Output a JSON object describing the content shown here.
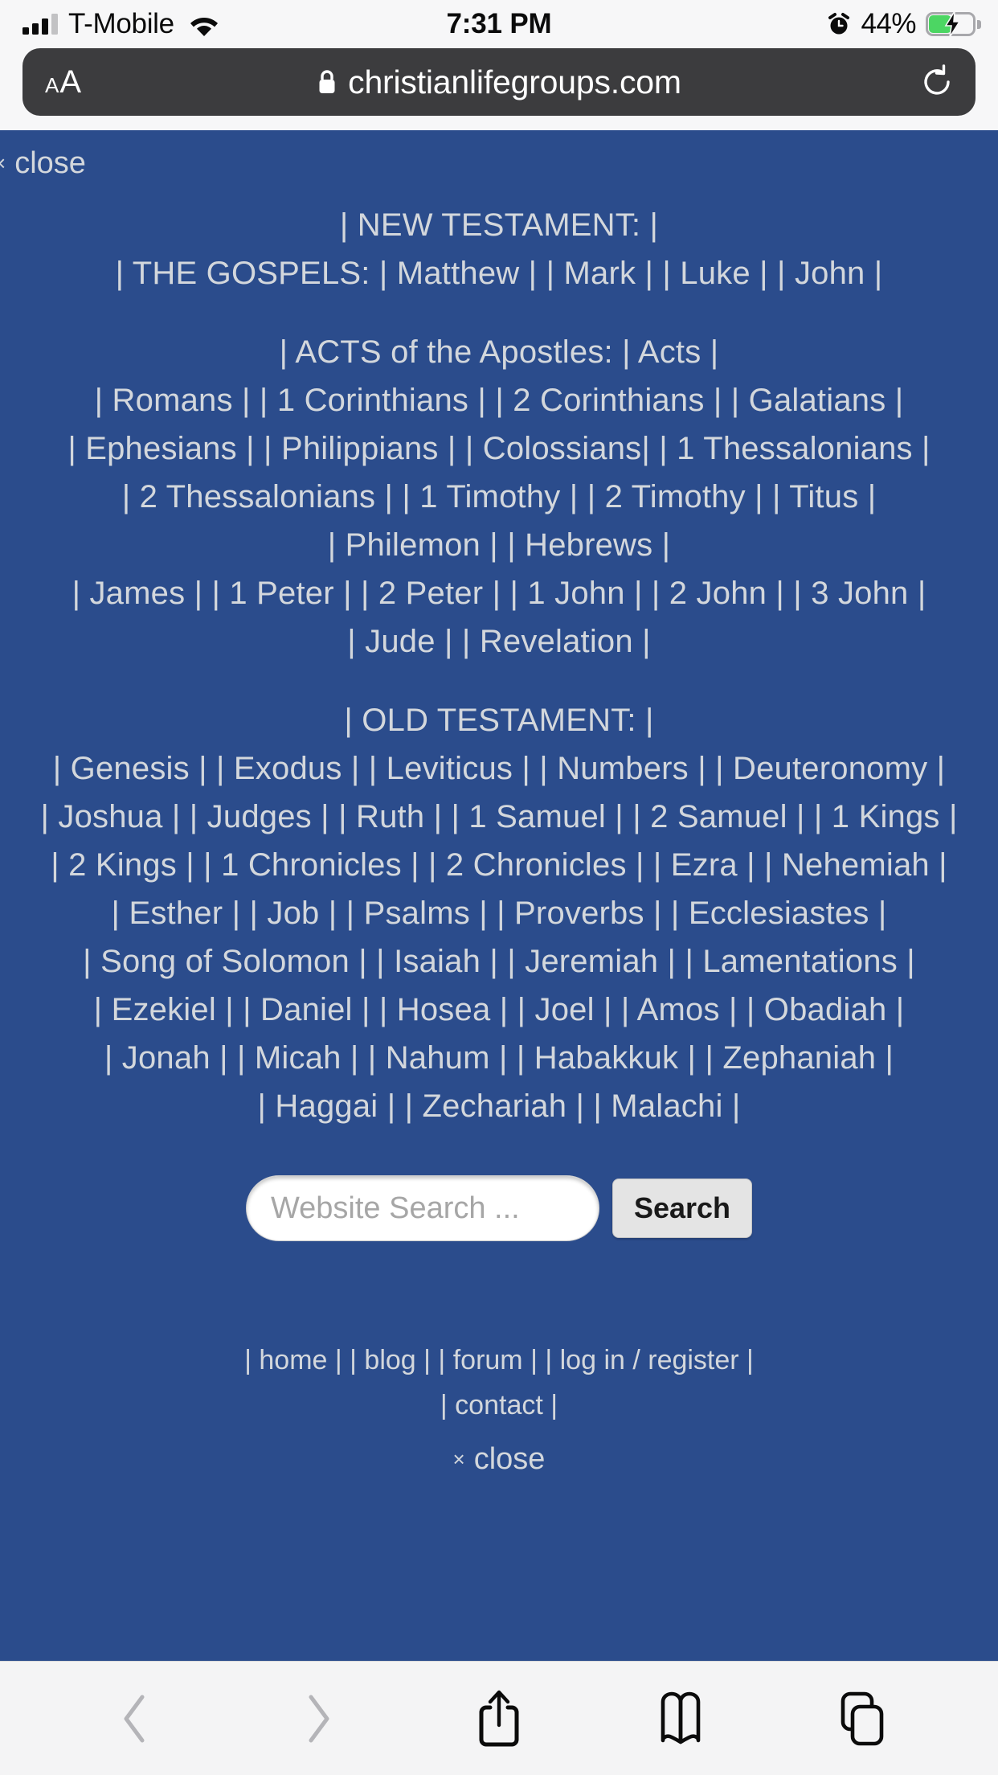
{
  "status_bar": {
    "carrier": "T-Mobile",
    "time": "7:31 PM",
    "battery_percent": "44%",
    "signal_bars_filled": 3,
    "signal_bars_total": 4,
    "icons": [
      "cellular-signal-icon",
      "wifi-icon",
      "alarm-clock-icon",
      "battery-charging-icon"
    ]
  },
  "browser": {
    "text_size_label_small": "A",
    "text_size_label_large": "A",
    "url": "christianlifegroups.com",
    "secure": true,
    "reload_icon": "reload-icon",
    "toolbar": {
      "back": "back-icon",
      "forward": "forward-icon",
      "share": "share-icon",
      "bookmarks": "bookmarks-icon",
      "tabs": "tabs-icon"
    }
  },
  "page": {
    "background_color": "#2B4C8C",
    "text_color": "#D3D7DC",
    "close_top": {
      "x": "×",
      "label": "close"
    },
    "sections": [
      {
        "heading": "| NEW TESTAMENT: |",
        "rows": [
          "| THE GOSPELS: | Matthew | | Mark | | Luke | | John |"
        ]
      },
      {
        "heading": "| ACTS of the Apostles: | Acts |",
        "rows": [
          "| Romans | | 1 Corinthians | | 2 Corinthians | | Galatians |",
          "| Ephesians | | Philippians | | Colossians| | 1 Thessalonians |",
          "| 2 Thessalonians | | 1 Timothy | | 2 Timothy | | Titus |",
          "| Philemon | | Hebrews |",
          "| James | | 1 Peter | | 2 Peter | | 1 John | | 2 John | | 3 John |",
          "| Jude | | Revelation |"
        ]
      },
      {
        "heading": "| OLD TESTAMENT: |",
        "rows": [
          "| Genesis | | Exodus | | Leviticus | | Numbers | | Deuteronomy |",
          "| Joshua | | Judges | | Ruth | | 1 Samuel | | 2 Samuel | | 1 Kings |",
          "| 2 Kings | | 1 Chronicles | | 2 Chronicles | | Ezra | | Nehemiah |",
          "| Esther | | Job | | Psalms | | Proverbs | | Ecclesiastes |",
          "| Song of Solomon | | Isaiah | | Jeremiah | | Lamentations |",
          "| Ezekiel | | Daniel | | Hosea | | Joel | | Amos | | Obadiah |",
          "| Jonah | | Micah | | Nahum | | Habakkuk | | Zephaniah |",
          "| Haggai | | Zechariah | | Malachi |"
        ]
      }
    ],
    "search": {
      "value": "",
      "placeholder": "Website Search ...",
      "button_label": "Search"
    },
    "footer": {
      "links_row_1": "| home | | blog | | forum | | log in / register |",
      "links_row_2": "| contact |",
      "close_bottom": {
        "x": "×",
        "label": "close"
      }
    }
  }
}
